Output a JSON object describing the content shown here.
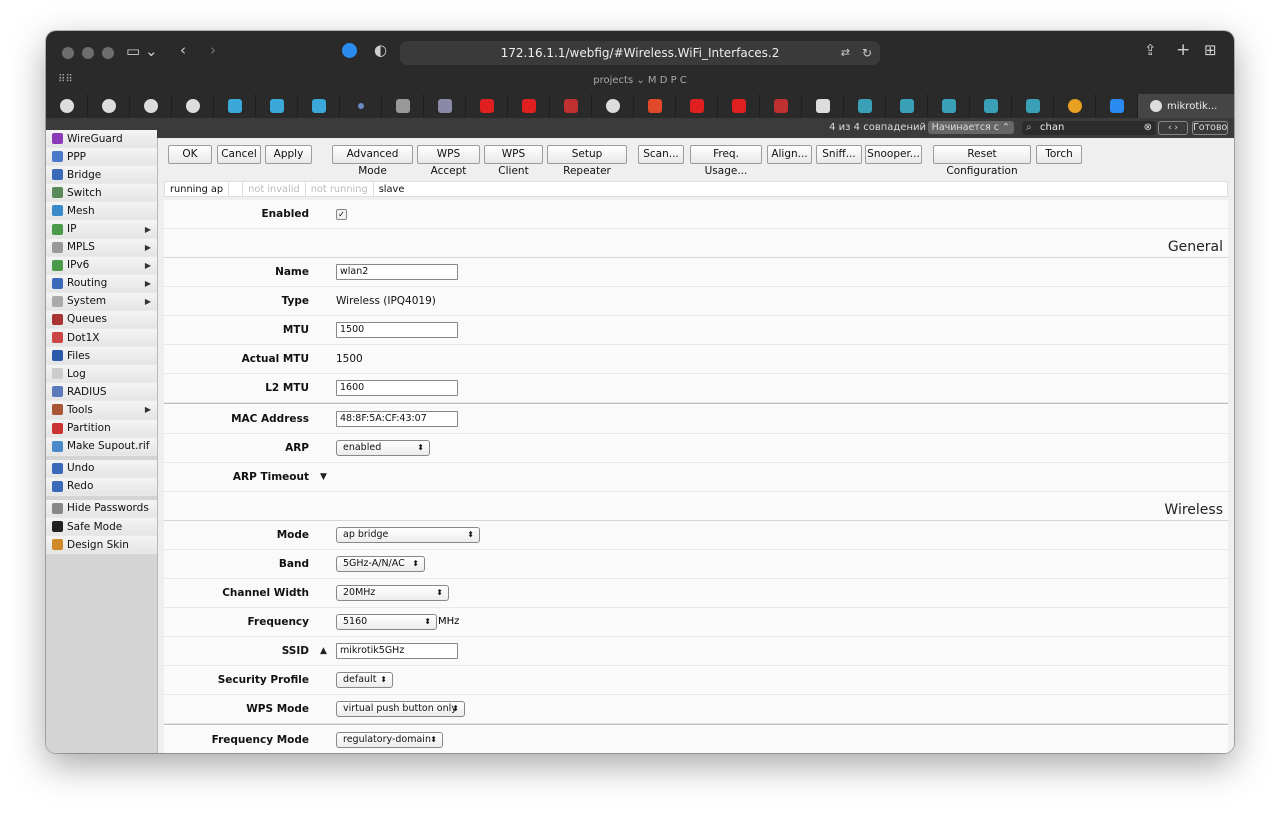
{
  "browser": {
    "url": "172.16.1.1/webfig/#Wireless.WiFi_Interfaces.2",
    "favorites_label": "projects ⌄  M  D  P  C",
    "active_tab_title": "mikrotik...",
    "find_count": "4 из 4 совпадений",
    "find_mode": "Начинается с ⌃",
    "find_query": "chan",
    "find_done": "Готово"
  },
  "sidebar": {
    "items": [
      {
        "label": "WireGuard",
        "color": "#8a3ab9"
      },
      {
        "label": "PPP",
        "color": "#4a7ac9"
      },
      {
        "label": "Bridge",
        "color": "#3a6ab9"
      },
      {
        "label": "Switch",
        "color": "#5a8a5a"
      },
      {
        "label": "Mesh",
        "color": "#3a8ac9"
      },
      {
        "label": "IP",
        "color": "#4a9a4a",
        "arrow": "▶"
      },
      {
        "label": "MPLS",
        "color": "#999999",
        "arrow": "▶"
      },
      {
        "label": "IPv6",
        "color": "#4a9a4a",
        "arrow": "▶"
      },
      {
        "label": "Routing",
        "color": "#3a6ab9",
        "arrow": "▶"
      },
      {
        "label": "System",
        "color": "#aaaaaa",
        "arrow": "▶"
      },
      {
        "label": "Queues",
        "color": "#aa3333"
      },
      {
        "label": "Dot1X",
        "color": "#cc4444"
      },
      {
        "label": "Files",
        "color": "#2a5aa9"
      },
      {
        "label": "Log",
        "color": "#cccccc"
      },
      {
        "label": "RADIUS",
        "color": "#5a7ab9"
      },
      {
        "label": "Tools",
        "color": "#aa5533",
        "arrow": "▶"
      },
      {
        "label": "Partition",
        "color": "#cc3333"
      },
      {
        "label": "Make Supout.rif",
        "color": "#4a8ac9"
      }
    ],
    "items2": [
      {
        "label": "Undo",
        "color": "#3a6ab9"
      },
      {
        "label": "Redo",
        "color": "#3a6ab9"
      }
    ],
    "items3": [
      {
        "label": "Hide Passwords",
        "color": "#888888"
      },
      {
        "label": "Safe Mode",
        "color": "#222222"
      },
      {
        "label": "Design Skin",
        "color": "#d08a2a"
      }
    ]
  },
  "toolbar": {
    "ok": "OK",
    "cancel": "Cancel",
    "apply": "Apply",
    "advanced": "Advanced Mode",
    "wps_accept": "WPS Accept",
    "wps_client": "WPS Client",
    "setup_repeater": "Setup Repeater",
    "scan": "Scan...",
    "freq_usage": "Freq. Usage...",
    "align": "Align...",
    "sniff": "Sniff...",
    "snooper": "Snooper...",
    "reset_config": "Reset Configuration",
    "torch": "Torch"
  },
  "status": [
    "running ap",
    "",
    "not invalid",
    "not running",
    "slave"
  ],
  "form": {
    "enabled_label": "Enabled",
    "general_title": "General",
    "name_label": "Name",
    "name_value": "wlan2",
    "type_label": "Type",
    "type_value": "Wireless (IPQ4019)",
    "mtu_label": "MTU",
    "mtu_value": "1500",
    "actual_mtu_label": "Actual MTU",
    "actual_mtu_value": "1500",
    "l2mtu_label": "L2 MTU",
    "l2mtu_value": "1600",
    "mac_label": "MAC Address",
    "mac_value": "48:8F:5A:CF:43:07",
    "arp_label": "ARP",
    "arp_value": "enabled",
    "arp_timeout_label": "ARP Timeout",
    "wireless_title": "Wireless",
    "mode_label": "Mode",
    "mode_value": "ap bridge",
    "band_label": "Band",
    "band_value": "5GHz-A/N/AC",
    "chwidth_label": "Channel Width",
    "chwidth_value": "20MHz",
    "freq_label": "Frequency",
    "freq_value": "5160",
    "freq_unit": "MHz",
    "ssid_label": "SSID",
    "ssid_value": "mikrotik5GHz",
    "secprof_label": "Security Profile",
    "secprof_value": "default",
    "wps_label": "WPS Mode",
    "wps_value": "virtual push button only",
    "freqmode_label": "Frequency Mode",
    "freqmode_value": "regulatory-domain"
  }
}
